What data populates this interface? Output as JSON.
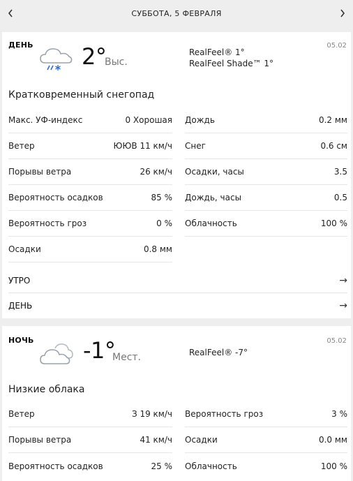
{
  "header": {
    "prev_icon": "chevron-left-icon",
    "title": "СУББОТА, 5 ФЕВРАЛЯ",
    "next_icon": "chevron-right-icon"
  },
  "day": {
    "period": "ДЕНЬ",
    "date": "05.02",
    "icon": "cloud-snow-icon",
    "temp": "2°",
    "temp_label": "Выс.",
    "realfeel": "RealFeel® 1°",
    "realfeel_shade": "RealFeel Shade™ 1°",
    "phrase": "Кратковременный снегопад",
    "left": [
      {
        "label": "Макс. УФ-индекс",
        "value": "0 Хорошая"
      },
      {
        "label": "Ветер",
        "value": "ЮЮВ 11 км/ч"
      },
      {
        "label": "Порывы ветра",
        "value": "26 км/ч"
      },
      {
        "label": "Вероятность осадков",
        "value": "85 %"
      },
      {
        "label": "Вероятность гроз",
        "value": "0 %"
      },
      {
        "label": "Осадки",
        "value": "0.8 мм"
      }
    ],
    "right": [
      {
        "label": "Дождь",
        "value": "0.2 мм"
      },
      {
        "label": "Снег",
        "value": "0.6 см"
      },
      {
        "label": "Осадки, часы",
        "value": "3.5"
      },
      {
        "label": "Дождь, часы",
        "value": "0.5"
      },
      {
        "label": "Облачность",
        "value": "100 %"
      }
    ],
    "links": [
      {
        "label": "УТРО",
        "arrow": "→"
      },
      {
        "label": "ДЕНЬ",
        "arrow": "→"
      }
    ]
  },
  "night": {
    "period": "НОЧЬ",
    "date": "05.02",
    "icon": "cloud-icon",
    "temp": "-1°",
    "temp_label": "Мест.",
    "realfeel": "RealFeel® -7°",
    "phrase": "Низкие облака",
    "left": [
      {
        "label": "Ветер",
        "value": "З 19 км/ч"
      },
      {
        "label": "Порывы ветра",
        "value": "41 км/ч"
      },
      {
        "label": "Вероятность осадков",
        "value": "25 %"
      }
    ],
    "right": [
      {
        "label": "Вероятность гроз",
        "value": "3 %"
      },
      {
        "label": "Осадки",
        "value": "0.0 мм"
      },
      {
        "label": "Облачность",
        "value": "100 %"
      }
    ]
  }
}
